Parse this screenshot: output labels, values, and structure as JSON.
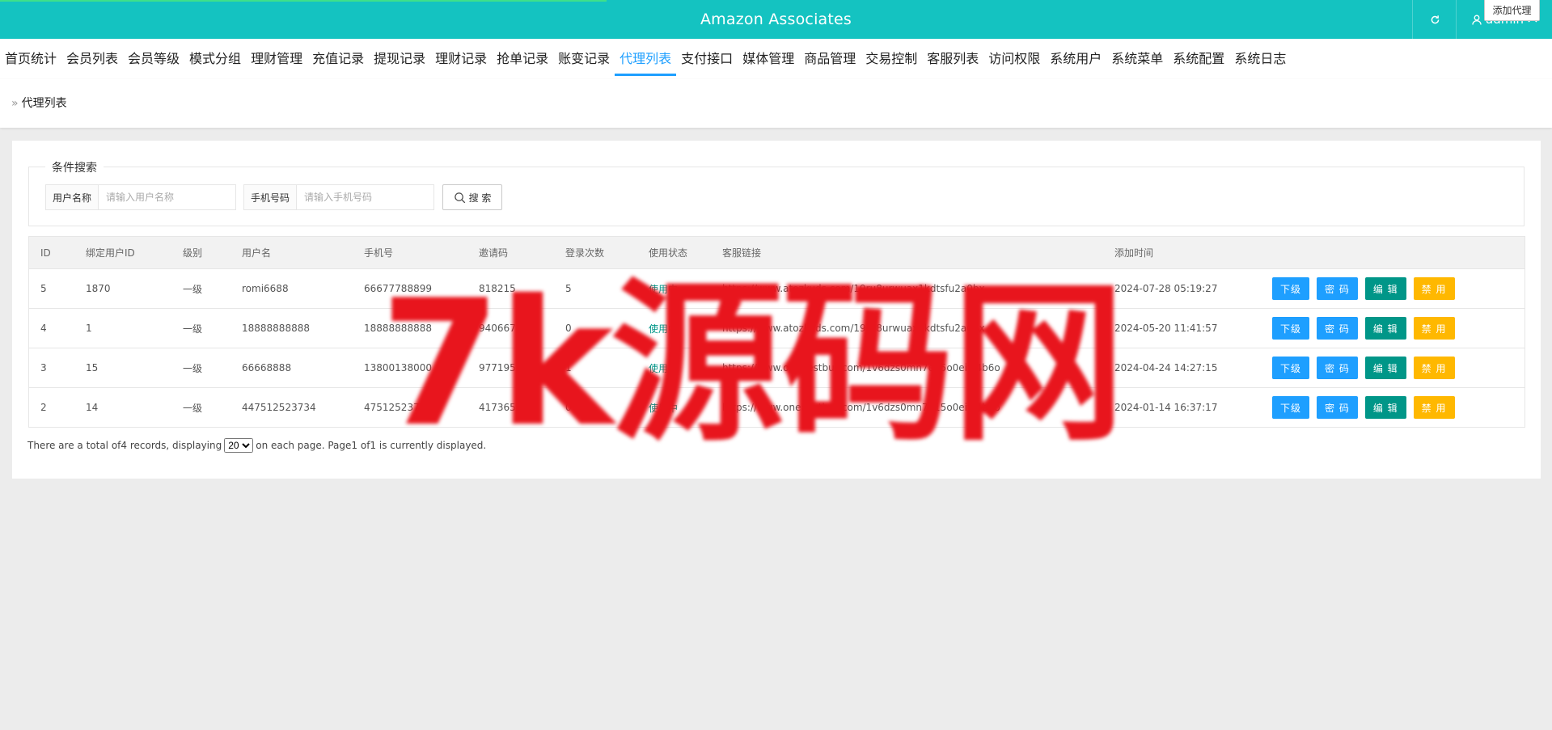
{
  "header": {
    "title": "Amazon Associates",
    "user": "admin"
  },
  "nav": {
    "items": [
      {
        "label": "首页统计"
      },
      {
        "label": "会员列表"
      },
      {
        "label": "会员等级"
      },
      {
        "label": "模式分组"
      },
      {
        "label": "理财管理"
      },
      {
        "label": "充值记录"
      },
      {
        "label": "提现记录"
      },
      {
        "label": "理财记录"
      },
      {
        "label": "抢单记录"
      },
      {
        "label": "账变记录"
      },
      {
        "label": "代理列表",
        "active": true
      },
      {
        "label": "支付接口"
      },
      {
        "label": "媒体管理"
      },
      {
        "label": "商品管理"
      },
      {
        "label": "交易控制"
      },
      {
        "label": "客服列表"
      },
      {
        "label": "访问权限"
      },
      {
        "label": "系统用户"
      },
      {
        "label": "系统菜单"
      },
      {
        "label": "系统配置"
      },
      {
        "label": "系统日志"
      }
    ]
  },
  "breadcrumb": {
    "current": "代理列表"
  },
  "toolbar": {
    "add_label": "添加代理"
  },
  "search": {
    "legend": "条件搜索",
    "username_label": "用户名称",
    "username_placeholder": "请输入用户名称",
    "phone_label": "手机号码",
    "phone_placeholder": "请输入手机号码",
    "button_label": "搜 索"
  },
  "table": {
    "headers": {
      "id": "ID",
      "bind": "绑定用户ID",
      "level": "级别",
      "user": "用户名",
      "phone": "手机号",
      "invite": "邀请码",
      "login": "登录次数",
      "status": "使用状态",
      "link": "客服链接",
      "time": "添加时间"
    },
    "rows": [
      {
        "id": "5",
        "bind": "1870",
        "level": "一级",
        "user": "romi6688",
        "phone": "66677788899",
        "invite": "818215",
        "login": "5",
        "status": "使用中",
        "link": "https://www.atozkuds.com/19ru8urwuax1kdtsfu2a0bx",
        "time": "2024-07-28 05:19:27"
      },
      {
        "id": "4",
        "bind": "1",
        "level": "一级",
        "user": "18888888888",
        "phone": "18888888888",
        "invite": "940667",
        "login": "0",
        "status": "使用中",
        "link": "https://www.atozkuds.com/19ru8urwuax1kdtsfu2a0bx",
        "time": "2024-05-20 11:41:57"
      },
      {
        "id": "3",
        "bind": "15",
        "level": "一级",
        "user": "66668888",
        "phone": "13800138000",
        "invite": "977195",
        "login": "1",
        "status": "使用中",
        "link": "https://www.onebestbuy.com/1v6dzs0mn7e15o0eifz4b6o",
        "time": "2024-04-24 14:27:15"
      },
      {
        "id": "2",
        "bind": "14",
        "level": "一级",
        "user": "447512523734",
        "phone": "47512523734",
        "invite": "417365",
        "login": "0",
        "status": "使用中",
        "link": "https://www.onebestbuy.com/1v6dzs0mn7e15o0eifz4b6o",
        "time": "2024-01-14 16:37:17"
      }
    ],
    "actions": {
      "sub": "下级",
      "password": "密 码",
      "edit": "编 辑",
      "disable": "禁 用"
    }
  },
  "pager": {
    "prefix": "There are a total of4 records, displaying",
    "page_size": "20",
    "suffix": "on each page. Page1 of1 is currently displayed."
  },
  "watermark": {
    "text": "7k源码网"
  },
  "colors": {
    "header_bg": "#14c3c1",
    "nav_active": "#1e9fff",
    "btn_blue": "#1e9fff",
    "btn_green": "#009688",
    "btn_orange": "#ffb800",
    "watermark": "#e8151d"
  }
}
